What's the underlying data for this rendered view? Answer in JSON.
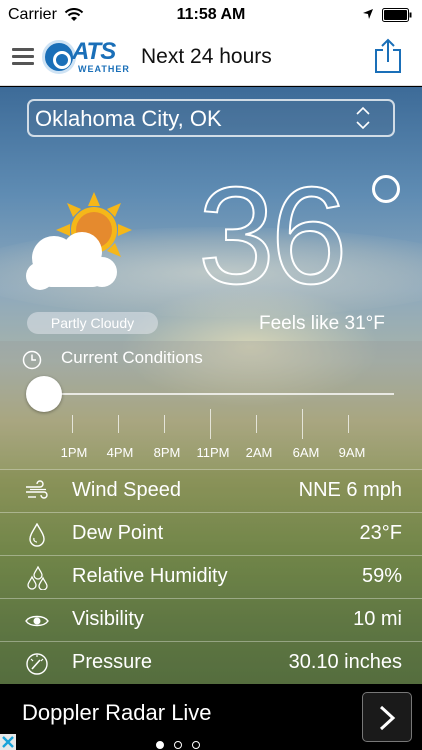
{
  "status_bar": {
    "carrier": "Carrier",
    "time": "11:58 AM"
  },
  "nav": {
    "title": "Next 24 hours",
    "logo_text": "ATS",
    "logo_sub": "WEATHER"
  },
  "location": {
    "selected": "Oklahoma City, OK"
  },
  "current": {
    "temperature": "36",
    "condition": "Partly Cloudy",
    "feels_like": "Feels like  31°F",
    "icon": "partly-cloudy-icon"
  },
  "timeline": {
    "title": "Current Conditions",
    "slider_position": 0,
    "ticks": [
      "1PM",
      "4PM",
      "8PM",
      "11PM",
      "2AM",
      "6AM",
      "9AM"
    ]
  },
  "conditions": [
    {
      "icon": "wind-icon",
      "label": "Wind Speed",
      "value": "NNE 6 mph"
    },
    {
      "icon": "dew-drop-icon",
      "label": "Dew Point",
      "value": "23°F"
    },
    {
      "icon": "humidity-drops-icon",
      "label": "Relative Humidity",
      "value": "59%"
    },
    {
      "icon": "eye-icon",
      "label": "Visibility",
      "value": "10 mi"
    },
    {
      "icon": "gauge-icon",
      "label": "Pressure",
      "value": "30.10 inches"
    }
  ],
  "ad": {
    "title": "Doppler Radar Live",
    "pages": 3,
    "active_page": 0
  },
  "colors": {
    "accent": "#1a6fb8",
    "sun": "#f5b719",
    "sun_core": "#e58a2e"
  }
}
